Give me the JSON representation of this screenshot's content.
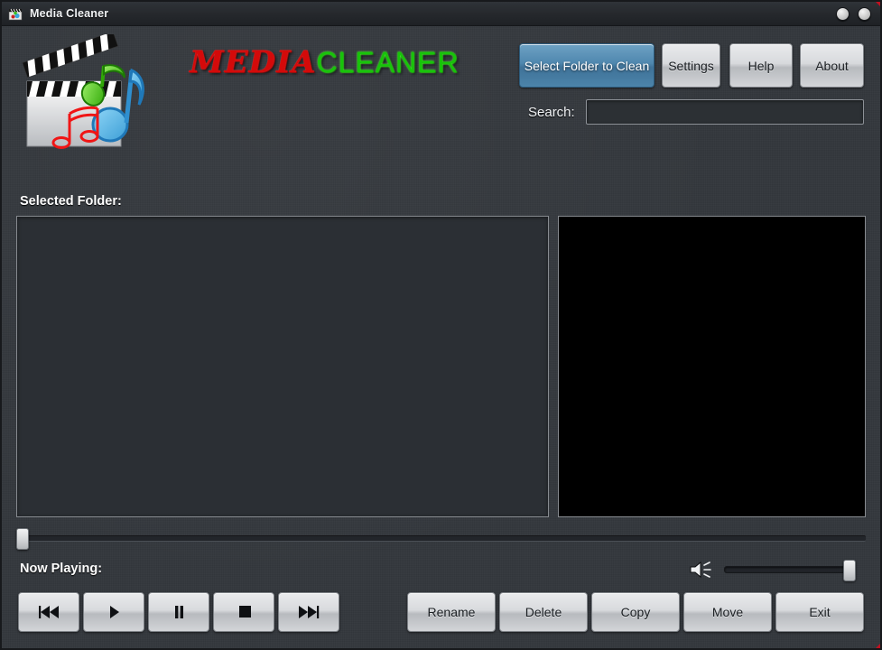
{
  "window": {
    "title": "Media Cleaner",
    "icon": "clapperboard-icon",
    "controls": [
      {
        "name": "minimize-button",
        "glyph": "circle"
      },
      {
        "name": "close-button",
        "glyph": "circle"
      }
    ],
    "accent_red": "#c01020",
    "background": "#34383d"
  },
  "logo": {
    "icon": "media-clapperboard-music-icon",
    "word_one": "MEDIA",
    "word_two": "CLEANER",
    "color_one": "#d40a0a",
    "color_two": "#17c409"
  },
  "toolbar": {
    "select_folder_label": "Select Folder to Clean",
    "settings_label": "Settings",
    "help_label": "Help",
    "about_label": "About",
    "primary_color": "#4f87ae"
  },
  "search": {
    "label": "Search:",
    "value": "",
    "placeholder": ""
  },
  "content": {
    "selected_folder_label": "Selected Folder:",
    "file_list_items": [],
    "preview_background": "#000000"
  },
  "seek": {
    "name": "seek-slider",
    "value": 0,
    "min": 0,
    "max": 100
  },
  "player": {
    "now_playing_label": "Now Playing:",
    "now_playing_value": ""
  },
  "volume": {
    "icon": "speaker-volume-icon",
    "value": 100,
    "min": 0,
    "max": 100
  },
  "transport": [
    {
      "name": "previous-button",
      "icon": "skip-previous-icon",
      "label": "Previous"
    },
    {
      "name": "play-button",
      "icon": "play-icon",
      "label": "Play"
    },
    {
      "name": "pause-button",
      "icon": "pause-icon",
      "label": "Pause"
    },
    {
      "name": "stop-button",
      "icon": "stop-icon",
      "label": "Stop"
    },
    {
      "name": "next-button",
      "icon": "skip-next-icon",
      "label": "Next"
    }
  ],
  "actions": [
    {
      "name": "rename-button",
      "label": "Rename"
    },
    {
      "name": "delete-button",
      "label": "Delete"
    },
    {
      "name": "copy-button",
      "label": "Copy"
    },
    {
      "name": "move-button",
      "label": "Move"
    },
    {
      "name": "exit-button",
      "label": "Exit"
    }
  ]
}
